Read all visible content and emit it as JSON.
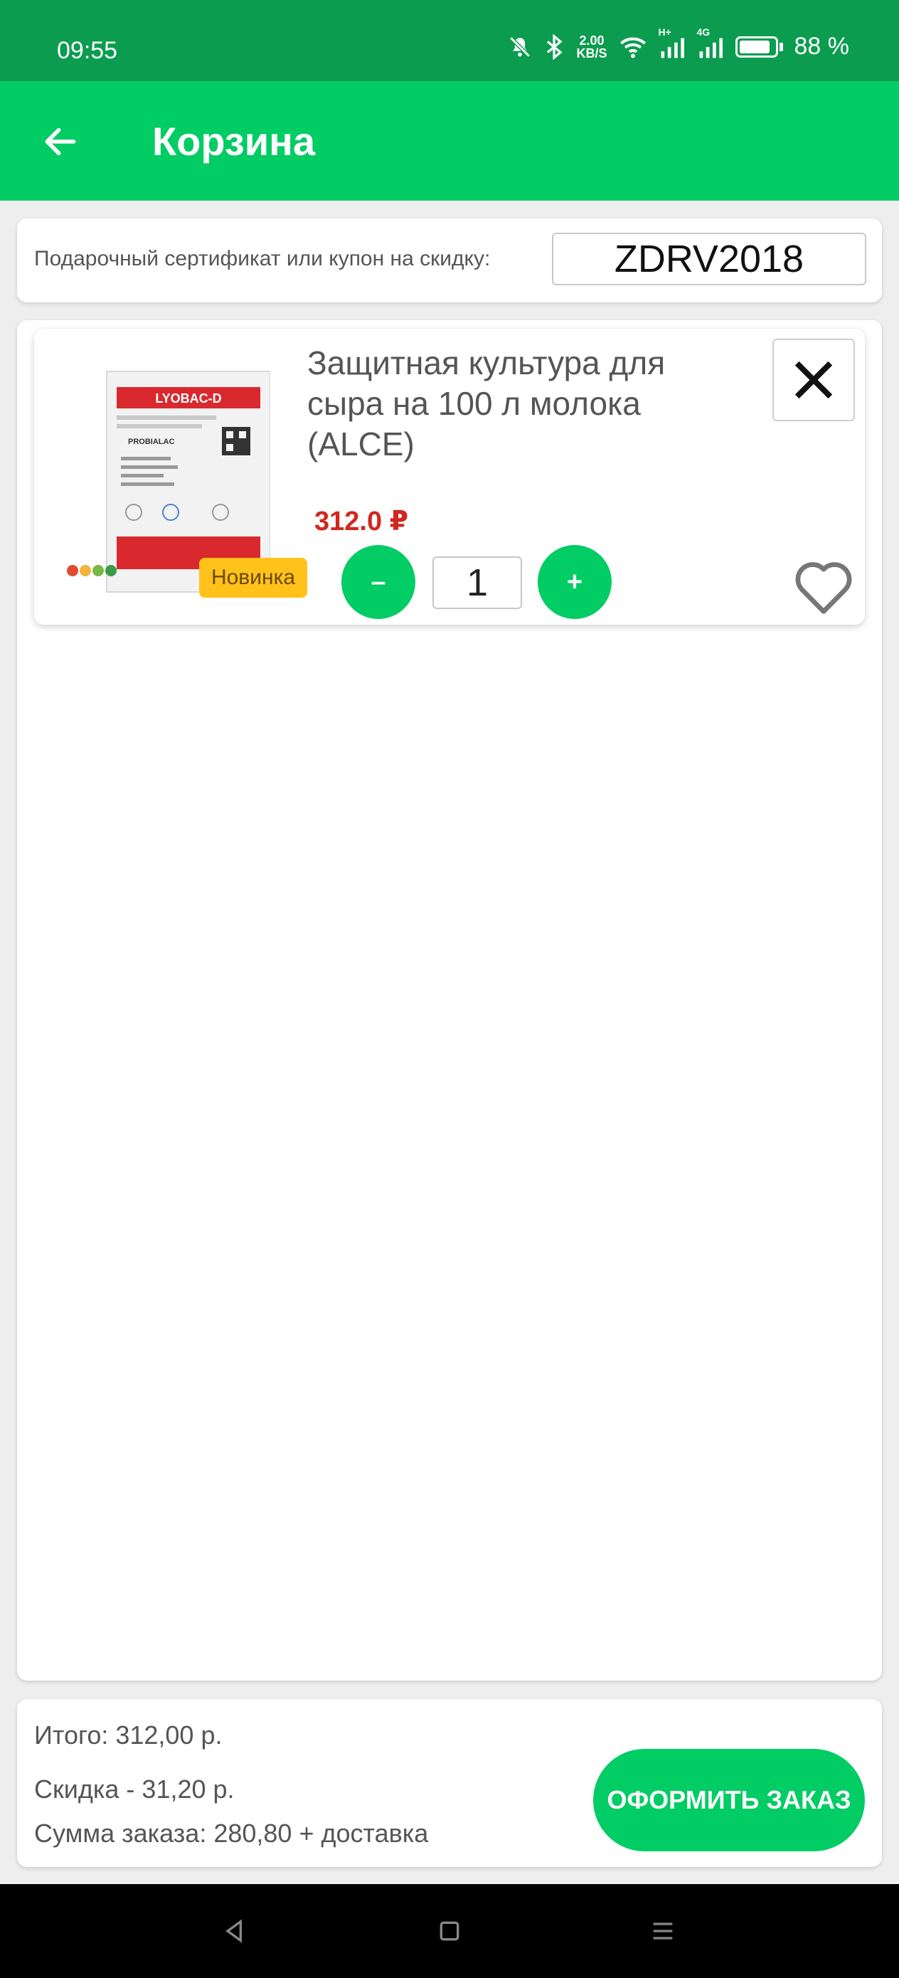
{
  "status_bar": {
    "time": "09:55",
    "net_speed_value": "2.00",
    "net_speed_unit": "KB/S",
    "signal_type_1": "H+",
    "signal_type_2": "4G",
    "battery_percent": "88 %",
    "battery_level": 0.88,
    "icons": [
      "bell-muted-icon",
      "bluetooth-icon",
      "wifi-icon",
      "cell-signal-icon",
      "battery-icon"
    ]
  },
  "app_bar": {
    "title": "Корзина",
    "back_icon": "arrow-left-icon"
  },
  "coupon": {
    "label": "Подарочный сертификат или купон на скидку:",
    "value": "ZDRV2018"
  },
  "cart": {
    "items": [
      {
        "title": "Защитная культура для сыра на 100 л молока (ALCE)",
        "price": "312.0 ₽",
        "badge": "Новинка",
        "quantity": "1",
        "minus_label": "–",
        "plus_label": "+",
        "image_brand_text": "LYOBAC-D",
        "image_product_text": "PROBIALAC"
      }
    ]
  },
  "summary": {
    "total": "Итого:  312,00 р.",
    "discount": "Скидка - 31,20 р.",
    "order_sum": "Сумма заказа:  280,80 + доставка",
    "checkout_label": "ОФОРМИТЬ ЗАКАЗ"
  },
  "colors": {
    "status_bar": "#0b9c4f",
    "accent": "#02cc64",
    "price": "#d0281f",
    "badge": "#ffc21a"
  }
}
